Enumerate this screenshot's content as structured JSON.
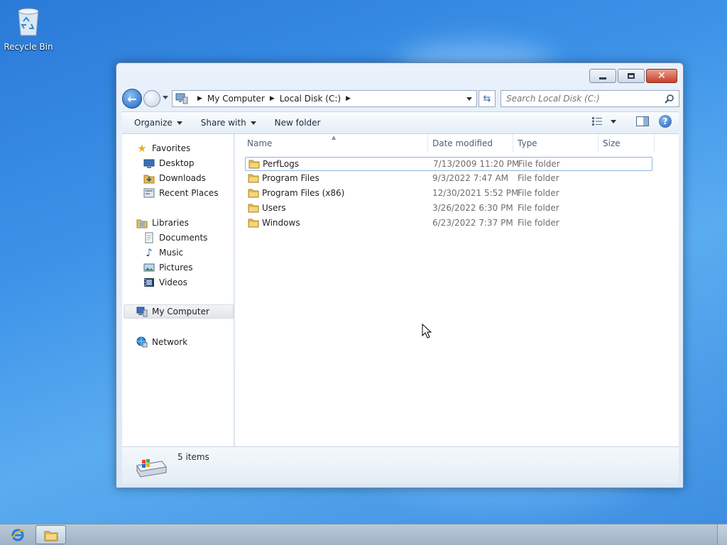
{
  "desktop": {
    "recycle_bin_label": "Recycle Bin"
  },
  "window": {
    "controls": {
      "minimize": "minimize",
      "maximize": "maximize",
      "close": "close"
    }
  },
  "address_bar": {
    "crumbs": [
      "My Computer",
      "Local Disk (C:)"
    ],
    "search_placeholder": "Search Local Disk (C:)"
  },
  "command_bar": {
    "organize": "Organize",
    "share_with": "Share with",
    "new_folder": "New folder"
  },
  "nav_pane": {
    "favorites": "Favorites",
    "favorites_items": [
      "Desktop",
      "Downloads",
      "Recent Places"
    ],
    "libraries": "Libraries",
    "libraries_items": [
      "Documents",
      "Music",
      "Pictures",
      "Videos"
    ],
    "computer": "My Computer",
    "network": "Network"
  },
  "file_list": {
    "columns": {
      "name": "Name",
      "date": "Date modified",
      "type": "Type",
      "size": "Size"
    },
    "rows": [
      {
        "name": "PerfLogs",
        "date": "7/13/2009 11:20 PM",
        "type": "File folder",
        "selected": true
      },
      {
        "name": "Program Files",
        "date": "9/3/2022 7:47 AM",
        "type": "File folder"
      },
      {
        "name": "Program Files (x86)",
        "date": "12/30/2021 5:52 PM",
        "type": "File folder"
      },
      {
        "name": "Users",
        "date": "3/26/2022 6:30 PM",
        "type": "File folder"
      },
      {
        "name": "Windows",
        "date": "6/23/2022 7:37 PM",
        "type": "File folder"
      }
    ]
  },
  "details_pane": {
    "count": "5 items"
  },
  "colors": {
    "desktop": "#3d93e8",
    "accent": "#1e5fb8",
    "folder": "#e8b94a"
  }
}
